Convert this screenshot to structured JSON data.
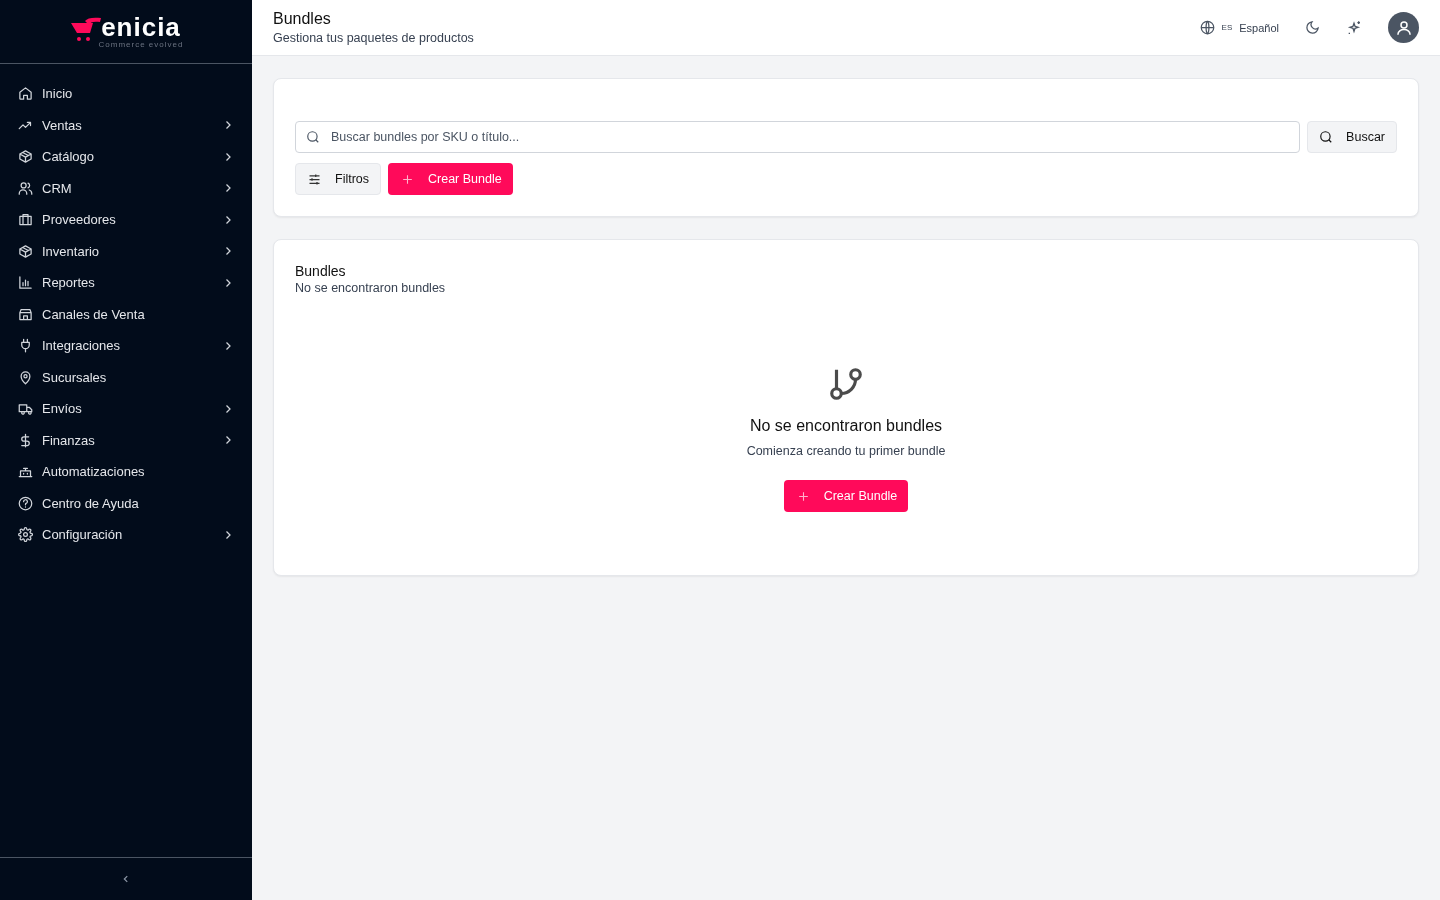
{
  "sidebar": {
    "logo": {
      "wordmark": "enicia",
      "tagline": "Commerce evolved"
    },
    "items": [
      {
        "label": "Inicio",
        "expandable": false
      },
      {
        "label": "Ventas",
        "expandable": true
      },
      {
        "label": "Catálogo",
        "expandable": true
      },
      {
        "label": "CRM",
        "expandable": true
      },
      {
        "label": "Proveedores",
        "expandable": true
      },
      {
        "label": "Inventario",
        "expandable": true
      },
      {
        "label": "Reportes",
        "expandable": true
      },
      {
        "label": "Canales de Venta",
        "expandable": false
      },
      {
        "label": "Integraciones",
        "expandable": true
      },
      {
        "label": "Sucursales",
        "expandable": false
      },
      {
        "label": "Envíos",
        "expandable": true
      },
      {
        "label": "Finanzas",
        "expandable": true
      },
      {
        "label": "Automatizaciones",
        "expandable": false
      },
      {
        "label": "Centro de Ayuda",
        "expandable": false
      },
      {
        "label": "Configuración",
        "expandable": true
      }
    ]
  },
  "header": {
    "title": "Bundles",
    "subtitle": "Gestiona tus paquetes de productos",
    "language_code": "ES",
    "language": "Español"
  },
  "search": {
    "placeholder": "Buscar bundles por SKU o título...",
    "button": "Buscar"
  },
  "actions": {
    "filters": "Filtros",
    "create": "Crear Bundle"
  },
  "list": {
    "title": "Bundles",
    "subtitle": "No se encontraron bundles",
    "empty": {
      "title": "No se encontraron bundles",
      "message": "Comienza creando tu primer bundle",
      "button": "Crear Bundle"
    }
  }
}
